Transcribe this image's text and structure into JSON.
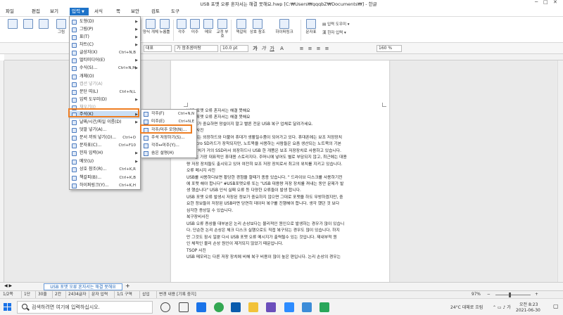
{
  "title": "USB 포맷 오류 혼자서는 해결 못해요.hwp [C:₩Users₩gqqbZ₩Documents₩] - 한글",
  "menus": [
    "파일",
    "편집",
    "보기",
    "입력",
    "서식",
    "쪽",
    "보안",
    "검토",
    "도구"
  ],
  "ribbon_left": [
    "그림",
    "도형",
    "표",
    "차트"
  ],
  "ribbon_right": [
    {
      "label": "양식 개체"
    },
    {
      "label": "누름틀"
    },
    {
      "label": "각주"
    },
    {
      "label": "미주"
    },
    {
      "label": "메모"
    },
    {
      "label": "교정 부호"
    },
    {
      "label": "책갈피"
    },
    {
      "label": "상호 참조"
    },
    {
      "label": "하이퍼링크"
    },
    {
      "label": "문자표"
    }
  ],
  "ribbon_side": [
    "입력 도우미",
    "한자 입력"
  ],
  "format": {
    "style": "대표",
    "font": "함초롬바탕",
    "size": "10.0",
    "unit": "pt",
    "zoom": "160",
    "zoom_unit": "%"
  },
  "insert_menu": [
    {
      "label": "도형(D)",
      "shortcut": "",
      "arrow": true,
      "disabled": false
    },
    {
      "label": "그림(P)",
      "shortcut": "",
      "arrow": true,
      "disabled": false
    },
    {
      "label": "표(T)",
      "shortcut": "",
      "arrow": true,
      "disabled": false
    },
    {
      "label": "차트(C)",
      "shortcut": "",
      "arrow": true,
      "disabled": false
    },
    {
      "label": "글상자(X)",
      "shortcut": "Ctrl+N,B",
      "arrow": false,
      "disabled": false
    },
    {
      "label": "멀티미디어(E)",
      "shortcut": "",
      "arrow": true,
      "disabled": false
    },
    {
      "label": "수식(S)...",
      "shortcut": "Ctrl+N,M",
      "arrow": true,
      "disabled": false
    },
    {
      "label": "개체(O)",
      "shortcut": "",
      "arrow": false,
      "disabled": false
    },
    {
      "label": "캡션 넣기(A)",
      "shortcut": "",
      "arrow": false,
      "disabled": true
    },
    {
      "label": "문단 띠(L)",
      "shortcut": "Ctrl+N,L",
      "arrow": false,
      "disabled": false
    },
    {
      "label": "입력 도우미(D)",
      "shortcut": "",
      "arrow": true,
      "disabled": false
    },
    {
      "label": "채우기(I)",
      "shortcut": "",
      "arrow": false,
      "disabled": true
    },
    {
      "label": "주석(K)",
      "shortcut": "",
      "arrow": true,
      "disabled": false
    },
    {
      "label": "날짜/시간/파일 이름(D)",
      "shortcut": "",
      "arrow": true,
      "disabled": false
    },
    {
      "label": "덧말 넣기(A)...",
      "shortcut": "",
      "arrow": false,
      "disabled": false
    },
    {
      "label": "문서 끼워 넣기(O)...",
      "shortcut": "Ctrl+O",
      "arrow": false,
      "disabled": false
    },
    {
      "label": "문자표(C)...",
      "shortcut": "Ctrl+F10",
      "arrow": false,
      "disabled": false
    },
    {
      "label": "한자 입력(H)",
      "shortcut": "",
      "arrow": true,
      "disabled": false
    },
    {
      "label": "메모(U)",
      "shortcut": "",
      "arrow": true,
      "disabled": false
    },
    {
      "label": "상호 참조(R)...",
      "shortcut": "Ctrl+K,R",
      "arrow": false,
      "disabled": false
    },
    {
      "label": "책갈피(B)...",
      "shortcut": "Ctrl+K,B",
      "arrow": false,
      "disabled": false
    },
    {
      "label": "하이퍼링크(Y)...",
      "shortcut": "Ctrl+K,H",
      "arrow": false,
      "disabled": false
    }
  ],
  "annotation_submenu": [
    {
      "label": "각주(F)",
      "shortcut": "Ctrl+N,N"
    },
    {
      "label": "미주(E)",
      "shortcut": "Ctrl+N,E"
    },
    {
      "label": "각주/미주 모양(N)...",
      "shortcut": ""
    },
    {
      "label": "주석 저장하기(S)...",
      "shortcut": ""
    },
    {
      "label": "각주↔미주(Y)...",
      "shortcut": ""
    },
    {
      "label": "숨은 설명(H)",
      "shortcut": ""
    }
  ],
  "document_lines": [
    "USB 포맷 오류 혼자서는 해결 못해요",
    "USB 포맷 오류 혼자서는 해결 못해요",
    "데이터가 중요하면 망설이지 말고 빨른 전문 USB 복구 업체로 달려가세요.",
    "USB 사진",
    "최근에는 외장하드와 더불어 휴대가 생활필수품이 되어가고 있다. 휴대폰에는 보조 저장장치",
    "로 Micro SD카드가 장착되지만, 노트북을 사용하는 사람들은 요즘 생산되는 노트북의 기본",
    "저장장치가 거의 SSD라서 외장하드나 USB 한 개쯤은 보조 저장장치로 사용하고 있습니다.",
    "USB는 가장 대표적인 휴대용 스토리지다. 주머니에 넣어도 별로 부담되지 않고, 최근에는 대용",
    "량 저장 장치들도 출시되고 있어 여전히 보조 저장 장치로서 최고의 위치를 지키고 있습니다.",
    "오류 메시지 사진",
    "USB를 사용하다보면 황당한 경험을 할때가 종종 있습니다. \" 드라이브 디스크를 사용하기전",
    "에 포맷 해야 합니다\" #USB포맷오류 또는 \"USB 대용량 저장 장치를 꺼내는 동안 문제가 발",
    "생 했습니다\" USB 인식 실패 오류 등 다양한 오류들이 발생 합니다.",
    "USB 포맷 오류 발생시 저장된 정보가 중요하지 않으면 그대로 포맷을 하도 무방하겠지만, 중",
    "요한 정보들이 저장된 USB라면 당연히 데이터 복구를 진행해야 합니다. 생각 했던 것 보다",
    "심각한 증상일 수 있습니다.",
    "복구장비사진",
    "USB 오류 증상을 대부분은 논리 손상보다는 물리적인 원인으로 발생하는 경우가 많이 있습니",
    "다. 단순한 논리 손상은 체크 디스크 실행으로도 직접 복구되는 경우도 많이 있습니다. 하지",
    "만 그것도 잠시 일뿐 다시 USB 포맷 오류 메시지가 출력될수 있는 것입니다. 제내부적 원",
    "인 체적인 물리 손상 원인이 제거되지 않았기 때문입니다.",
    "TSOP 사진",
    "USB 메모리는 다른 저장 장치에 비해 복구 비용이 많이 높은 편입니다. 논리 손상의 경우는"
  ],
  "doc_tab": "USB 포맷 오류 혼자서는 해결 못해요",
  "status": [
    "1/2쪽",
    "1단",
    "30줄",
    "2칸",
    "2434글자",
    "문자 입력",
    "1/1 구역",
    "삽입",
    "변경 내용 [기록 중지]"
  ],
  "zoom_status": "97%",
  "zoom_fraction": 0.4,
  "taskbar": {
    "search_placeholder": "검색하려면 여기에 입력하십시오.",
    "weather": "24°C 대체로 흐림",
    "time": "오전 8:23",
    "date": "2021-06-30"
  },
  "colors": {
    "accent": "#1e73c8",
    "highlight_outline": "#ee7d22"
  }
}
